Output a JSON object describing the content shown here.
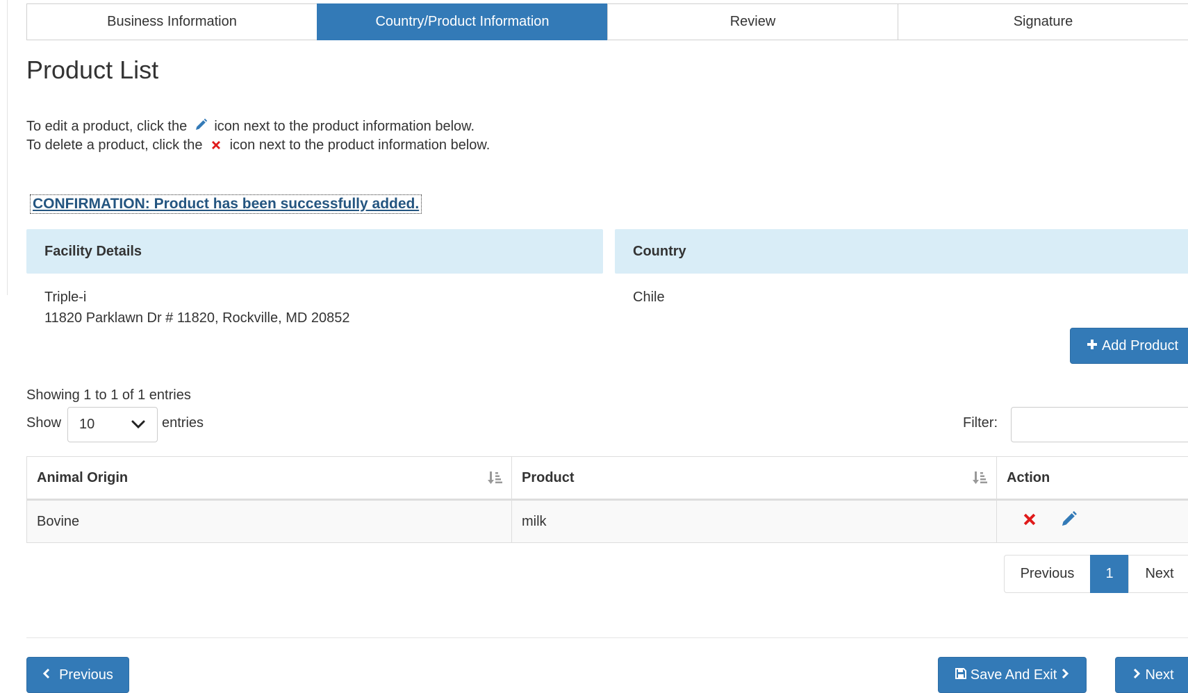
{
  "steps": [
    {
      "label": "Business Information",
      "active": false
    },
    {
      "label": "Country/Product Information",
      "active": true
    },
    {
      "label": "Review",
      "active": false
    },
    {
      "label": "Signature",
      "active": false
    }
  ],
  "page_title": "Product List",
  "instructions": {
    "edit_prefix": "To edit a product, click the",
    "edit_suffix": "icon next to the product information below.",
    "delete_prefix": "To delete a product, click the",
    "delete_suffix": "icon next to the product information below."
  },
  "confirmation": "CONFIRMATION: Product has been successfully added.",
  "facility": {
    "heading": "Facility Details",
    "name": "Triple-i",
    "address": "11820 Parklawn Dr # 11820, Rockville, MD 20852"
  },
  "country": {
    "heading": "Country",
    "value": "Chile"
  },
  "add_product_label": "Add Product",
  "table_info": {
    "showing": "Showing 1 to 1 of 1 entries",
    "show_label": "Show",
    "page_length": "10",
    "entries_label": "entries",
    "filter_label": "Filter:"
  },
  "table": {
    "columns": [
      "Animal Origin",
      "Product",
      "Action"
    ],
    "rows": [
      {
        "animal_origin": "Bovine",
        "product": "milk"
      }
    ]
  },
  "pagination": {
    "previous": "Previous",
    "current": "1",
    "next": "Next"
  },
  "footer": {
    "previous": "Previous",
    "save_exit": "Save And Exit",
    "next": "Next"
  },
  "colors": {
    "primary": "#337ab7",
    "panel_heading": "#d9edf7",
    "delete_icon": "#e01b1b"
  },
  "icons": [
    "pencil-icon",
    "delete-x-icon",
    "plus-icon",
    "sort-icon",
    "chevron-down-icon",
    "chevron-left-icon",
    "chevron-right-icon",
    "floppy-disk-icon"
  ]
}
